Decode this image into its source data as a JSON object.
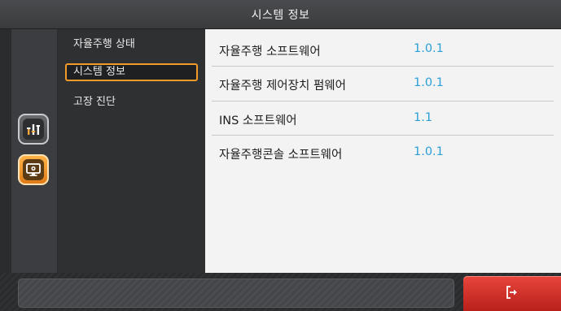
{
  "header": {
    "title": "시스템 정보"
  },
  "rail": {
    "items": [
      {
        "icon": "equalizer-icon",
        "state": "idle"
      },
      {
        "icon": "monitor-settings-icon",
        "state": "active"
      }
    ]
  },
  "submenu": {
    "items": [
      {
        "label": "자율주행 상태",
        "selected": false
      },
      {
        "label": "시스템 정보",
        "selected": true
      },
      {
        "label": "고장 진단",
        "selected": false
      }
    ]
  },
  "info": {
    "rows": [
      {
        "label": "자율주행 소프트웨어",
        "value": "1.0.1"
      },
      {
        "label": "자율주행 제어장치 펌웨어",
        "value": "1.0.1"
      },
      {
        "label": "INS 소프트웨어",
        "value": "1.1"
      },
      {
        "label": "자율주행콘솔 소프트웨어",
        "value": "1.0.1"
      }
    ]
  },
  "footer": {
    "status_text": "",
    "exit_icon": "exit-icon"
  },
  "colors": {
    "accent": "#f29b2b",
    "value": "#2a9fd8",
    "exit": "#d6322a"
  }
}
